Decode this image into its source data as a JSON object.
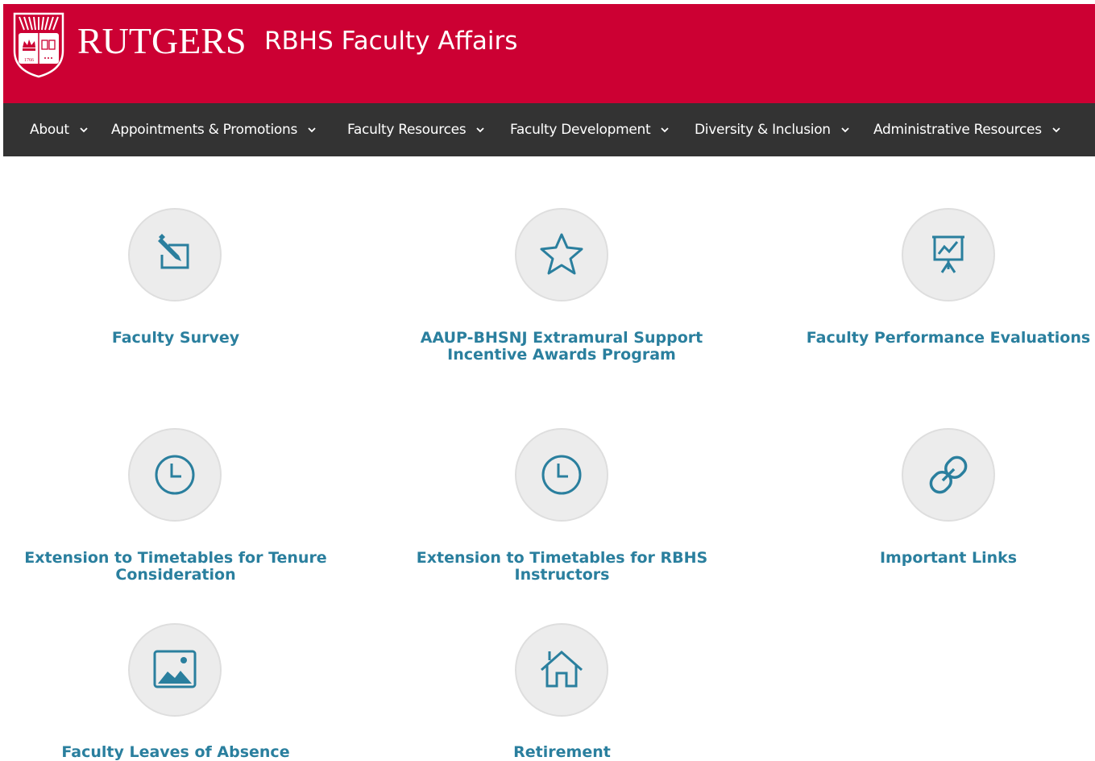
{
  "header": {
    "logo_text": "RUTGERS",
    "site_name": "RBHS Faculty Affairs",
    "shield_year": "1766",
    "bg_color": "#cc0033"
  },
  "nav": {
    "items": [
      {
        "label": "About",
        "icon": "chevron-down-icon"
      },
      {
        "label": "Appointments & Promotions",
        "icon": "chevron-down-icon"
      },
      {
        "label": "Faculty Resources",
        "icon": "chevron-down-icon"
      },
      {
        "label": "Faculty Development",
        "icon": "chevron-down-icon"
      },
      {
        "label": "Diversity & Inclusion",
        "icon": "chevron-down-icon"
      },
      {
        "label": "Administrative Resources",
        "icon": "chevron-down-icon"
      }
    ],
    "bg_color": "#333333"
  },
  "tiles": [
    {
      "label": "Faculty Survey",
      "icon": "edit-icon"
    },
    {
      "label": "AAUP-BHSNJ Extramural Support Incentive Awards Program",
      "icon": "star-icon"
    },
    {
      "label": "Faculty Performance Evaluations",
      "icon": "presentation-chart-icon"
    },
    {
      "label": "Extension to Timetables for Tenure Consideration",
      "icon": "clock-icon"
    },
    {
      "label": "Extension to Timetables for RBHS Instructors",
      "icon": "clock-icon"
    },
    {
      "label": "Important Links",
      "icon": "link-icon"
    },
    {
      "label": "Faculty Leaves of Absence",
      "icon": "image-icon"
    },
    {
      "label": "Retirement",
      "icon": "home-icon"
    }
  ],
  "colors": {
    "accent": "#2a7f9e",
    "icon_bg": "#ececec"
  }
}
